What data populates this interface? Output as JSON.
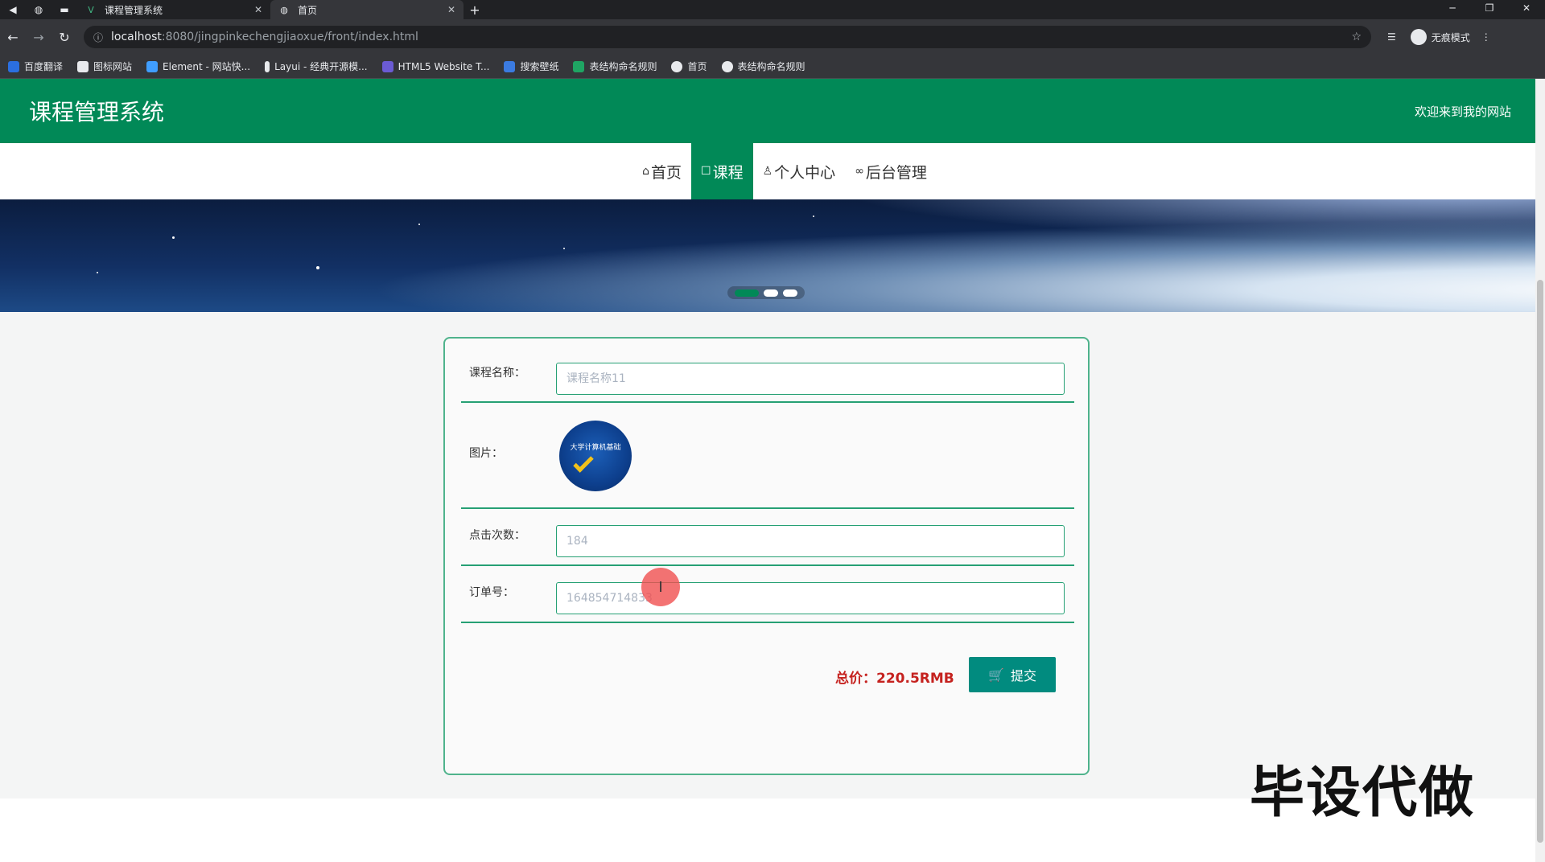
{
  "browser": {
    "tabs": [
      {
        "title": "课程管理系统",
        "icon": "vue-logo-icon",
        "active": false
      },
      {
        "title": "首页",
        "icon": "globe-icon",
        "active": true
      }
    ],
    "url_host": "localhost",
    "url_rest": ":8080/jingpinkechengjiaoxue/front/index.html",
    "incognito_label": "无痕模式",
    "bookmarks": [
      {
        "label": "百度翻译",
        "color": "#2b6fe0"
      },
      {
        "label": "图标网站",
        "color": "#e8eaed"
      },
      {
        "label": "Element - 网站快...",
        "color": "#409eff"
      },
      {
        "label": "Layui - 经典开源模...",
        "color": "#e8eaed"
      },
      {
        "label": "HTML5 Website T...",
        "color": "#6b5bd3"
      },
      {
        "label": "搜索壁纸",
        "color": "#3b7be0"
      },
      {
        "label": "表结构命名规则",
        "color": "#1fa463"
      },
      {
        "label": "首页",
        "color": "#e8eaed"
      },
      {
        "label": "表结构命名规则",
        "color": "#e8eaed"
      }
    ]
  },
  "site": {
    "title": "课程管理系统",
    "welcome": "欢迎来到我的网站",
    "brand_color": "#018957",
    "nav": [
      {
        "label": "首页",
        "icon": "home-icon",
        "active": false
      },
      {
        "label": "课程",
        "icon": "edit-icon",
        "active": true
      },
      {
        "label": "个人中心",
        "icon": "user-icon",
        "active": false
      },
      {
        "label": "后台管理",
        "icon": "link-icon",
        "active": false
      }
    ]
  },
  "form": {
    "course_name_label": "课程名称：",
    "course_name_value": "课程名称11",
    "image_label": "图片：",
    "image_caption": "大学计算机基础",
    "clicks_label": "点击次数：",
    "clicks_value": "184",
    "order_label": "订单号：",
    "order_value": "164854714833",
    "total": "总价：220.5RMB",
    "submit_label": "提交"
  },
  "watermark": "毕设代做"
}
